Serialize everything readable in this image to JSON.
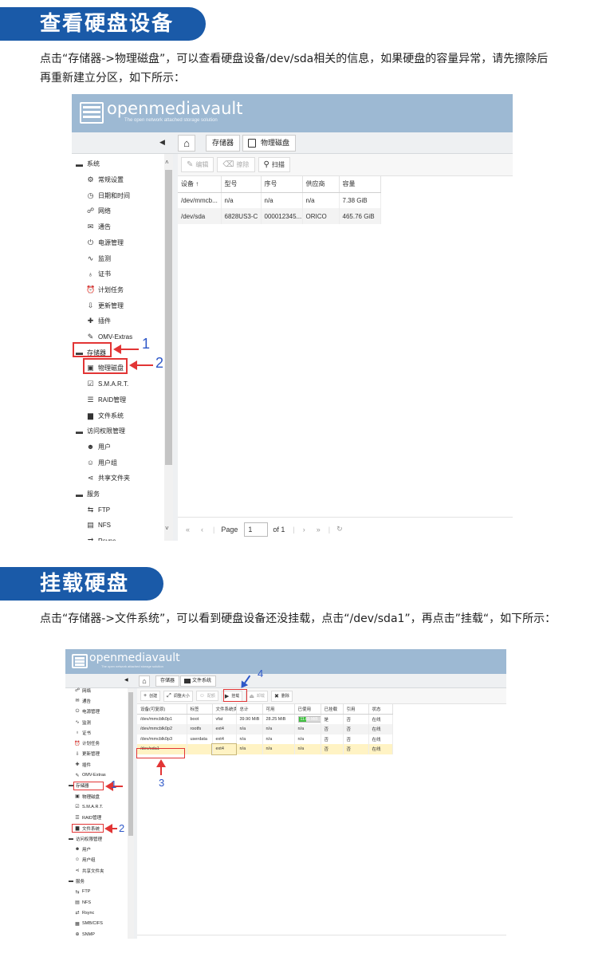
{
  "section1": {
    "title": "查看硬盘设备",
    "paragraph": "点击“存储器->物理磁盘”，可以查看硬盘设备/dev/sda相关的信息，如果硬盘的容量异常，请先擦除后再重新建立分区，如下所示："
  },
  "shot1": {
    "logo": {
      "title": "openmediavault",
      "subtitle": "The open network attached storage solution"
    },
    "collapse_glyph": "◀",
    "breadcrumb": [
      "存储器",
      "物理磁盘"
    ],
    "sidebar": [
      {
        "label": "系统",
        "icon": "minus-square-icon",
        "level": 0
      },
      {
        "label": "常规设置",
        "icon": "settings-icon",
        "level": 1
      },
      {
        "label": "日期和时间",
        "icon": "clock-icon",
        "level": 1
      },
      {
        "label": "网络",
        "icon": "network-icon",
        "level": 1
      },
      {
        "label": "通告",
        "icon": "envelope-icon",
        "level": 1
      },
      {
        "label": "电源管理",
        "icon": "power-icon",
        "level": 1
      },
      {
        "label": "监测",
        "icon": "chart-icon",
        "level": 1
      },
      {
        "label": "证书",
        "icon": "certificate-icon",
        "level": 1
      },
      {
        "label": "计划任务",
        "icon": "alarm-icon",
        "level": 1
      },
      {
        "label": "更新管理",
        "icon": "update-icon",
        "level": 1
      },
      {
        "label": "插件",
        "icon": "puzzle-icon",
        "level": 1
      },
      {
        "label": "OMV-Extras",
        "icon": "wrench-icon",
        "level": 1
      },
      {
        "label": "存储器",
        "icon": "minus-square-icon",
        "level": 0
      },
      {
        "label": "物理磁盘",
        "icon": "disk-icon",
        "level": 1
      },
      {
        "label": "S.M.A.R.T.",
        "icon": "smart-icon",
        "level": 1
      },
      {
        "label": "RAID管理",
        "icon": "database-icon",
        "level": 1
      },
      {
        "label": "文件系统",
        "icon": "folder-icon",
        "level": 1
      },
      {
        "label": "访问权限管理",
        "icon": "minus-square-icon",
        "level": 0
      },
      {
        "label": "用户",
        "icon": "user-icon",
        "level": 1
      },
      {
        "label": "用户组",
        "icon": "users-icon",
        "level": 1
      },
      {
        "label": "共享文件夹",
        "icon": "share-icon",
        "level": 1
      },
      {
        "label": "服务",
        "icon": "minus-square-icon",
        "level": 0
      },
      {
        "label": "FTP",
        "icon": "ftp-icon",
        "level": 1
      },
      {
        "label": "NFS",
        "icon": "nfs-icon",
        "level": 1
      },
      {
        "label": "Rsync",
        "icon": "rsync-icon",
        "level": 1
      }
    ],
    "actions": [
      {
        "label": "编辑",
        "icon": "edit-icon",
        "enabled": false
      },
      {
        "label": "擦除",
        "icon": "eraser-icon",
        "enabled": false
      },
      {
        "label": "扫描",
        "icon": "search-icon",
        "enabled": true
      }
    ],
    "columns": [
      "设备 ↑",
      "型号",
      "序号",
      "供应商",
      "容量"
    ],
    "rows": [
      [
        "/dev/mmcb...",
        "n/a",
        "n/a",
        "n/a",
        "7.38 GiB"
      ],
      [
        "/dev/sda",
        "6828US3-C",
        "000012345...",
        "ORICO",
        "465.76 GiB"
      ]
    ],
    "pager": {
      "first": "«",
      "prev": "‹",
      "page_label": "Page",
      "page_value": "1",
      "of_label": "of 1",
      "next": "›",
      "last": "»",
      "refresh": "↻"
    },
    "annotations": [
      "1",
      "2"
    ]
  },
  "section2": {
    "title": "挂载硬盘",
    "paragraph": "点击“存储器->文件系统”，可以看到硬盘设备还没挂载，点击“/dev/sda1”，再点击”挂载“，如下所示："
  },
  "shot2": {
    "logo": {
      "title": "openmediavault",
      "subtitle": "The open network attached storage solution"
    },
    "collapse_glyph": "◀",
    "breadcrumb": [
      "存储器",
      "文件系统"
    ],
    "sidebar": [
      {
        "label": "网络",
        "icon": "network-icon",
        "level": 1
      },
      {
        "label": "通告",
        "icon": "envelope-icon",
        "level": 1
      },
      {
        "label": "电源管理",
        "icon": "power-icon",
        "level": 1
      },
      {
        "label": "监测",
        "icon": "chart-icon",
        "level": 1
      },
      {
        "label": "证书",
        "icon": "certificate-icon",
        "level": 1
      },
      {
        "label": "计划任务",
        "icon": "alarm-icon",
        "level": 1
      },
      {
        "label": "更新管理",
        "icon": "update-icon",
        "level": 1
      },
      {
        "label": "插件",
        "icon": "puzzle-icon",
        "level": 1
      },
      {
        "label": "OMV-Extras",
        "icon": "wrench-icon",
        "level": 1
      },
      {
        "label": "存储器",
        "icon": "minus-square-icon",
        "level": 0
      },
      {
        "label": "物理磁盘",
        "icon": "disk-icon",
        "level": 1
      },
      {
        "label": "S.M.A.R.T.",
        "icon": "smart-icon",
        "level": 1
      },
      {
        "label": "RAID管理",
        "icon": "database-icon",
        "level": 1
      },
      {
        "label": "文件系统",
        "icon": "folder-icon",
        "level": 1
      },
      {
        "label": "访问权限管理",
        "icon": "minus-square-icon",
        "level": 0
      },
      {
        "label": "用户",
        "icon": "user-icon",
        "level": 1
      },
      {
        "label": "用户组",
        "icon": "users-icon",
        "level": 1
      },
      {
        "label": "共享文件夹",
        "icon": "share-icon",
        "level": 1
      },
      {
        "label": "服务",
        "icon": "minus-square-icon",
        "level": 0
      },
      {
        "label": "FTP",
        "icon": "ftp-icon",
        "level": 1
      },
      {
        "label": "NFS",
        "icon": "nfs-icon",
        "level": 1
      },
      {
        "label": "Rsync",
        "icon": "rsync-icon",
        "level": 1
      },
      {
        "label": "SMB/CIFS",
        "icon": "windows-icon",
        "level": 1
      },
      {
        "label": "SNMP",
        "icon": "snmp-icon",
        "level": 1
      }
    ],
    "actions": [
      {
        "label": "创建",
        "icon": "plus-icon",
        "enabled": true
      },
      {
        "label": "调整大小",
        "icon": "resize-icon",
        "enabled": true
      },
      {
        "label": "配额",
        "icon": "users-icon",
        "enabled": false
      },
      {
        "label": "挂载",
        "icon": "play-icon",
        "enabled": true
      },
      {
        "label": "卸载",
        "icon": "eject-icon",
        "enabled": false
      },
      {
        "label": "删除",
        "icon": "delete-icon",
        "enabled": true
      }
    ],
    "columns": [
      "设备(可复原)",
      "标签",
      "文件系统类型",
      "总计",
      "可用",
      "已使用",
      "已挂载",
      "引用",
      "状态"
    ],
    "rows": [
      [
        "/dev/mmcblk0p1",
        "boot",
        "vfat",
        "39.90 MiB",
        "28.25 MiB",
        "11.65 MiB",
        "是",
        "否",
        "在线"
      ],
      [
        "/dev/mmcblk0p2",
        "rootfs",
        "ext4",
        "n/a",
        "n/a",
        "n/a",
        "否",
        "否",
        "在线"
      ],
      [
        "/dev/mmcblk0p3",
        "userdata",
        "ext4",
        "n/a",
        "n/a",
        "n/a",
        "否",
        "否",
        "在线"
      ],
      [
        "/dev/sda1",
        "",
        "ext4",
        "n/a",
        "n/a",
        "n/a",
        "否",
        "否",
        "在线"
      ]
    ],
    "used_fraction_row1": 0.29,
    "annotations": [
      "1",
      "2",
      "3",
      "4"
    ]
  },
  "colors": {
    "accent": "#1a5aa8",
    "banner": "#9db9d3",
    "annotation_red": "#e23535",
    "annotation_blue": "#2d57c8",
    "selected_row": "#fff3c4"
  }
}
